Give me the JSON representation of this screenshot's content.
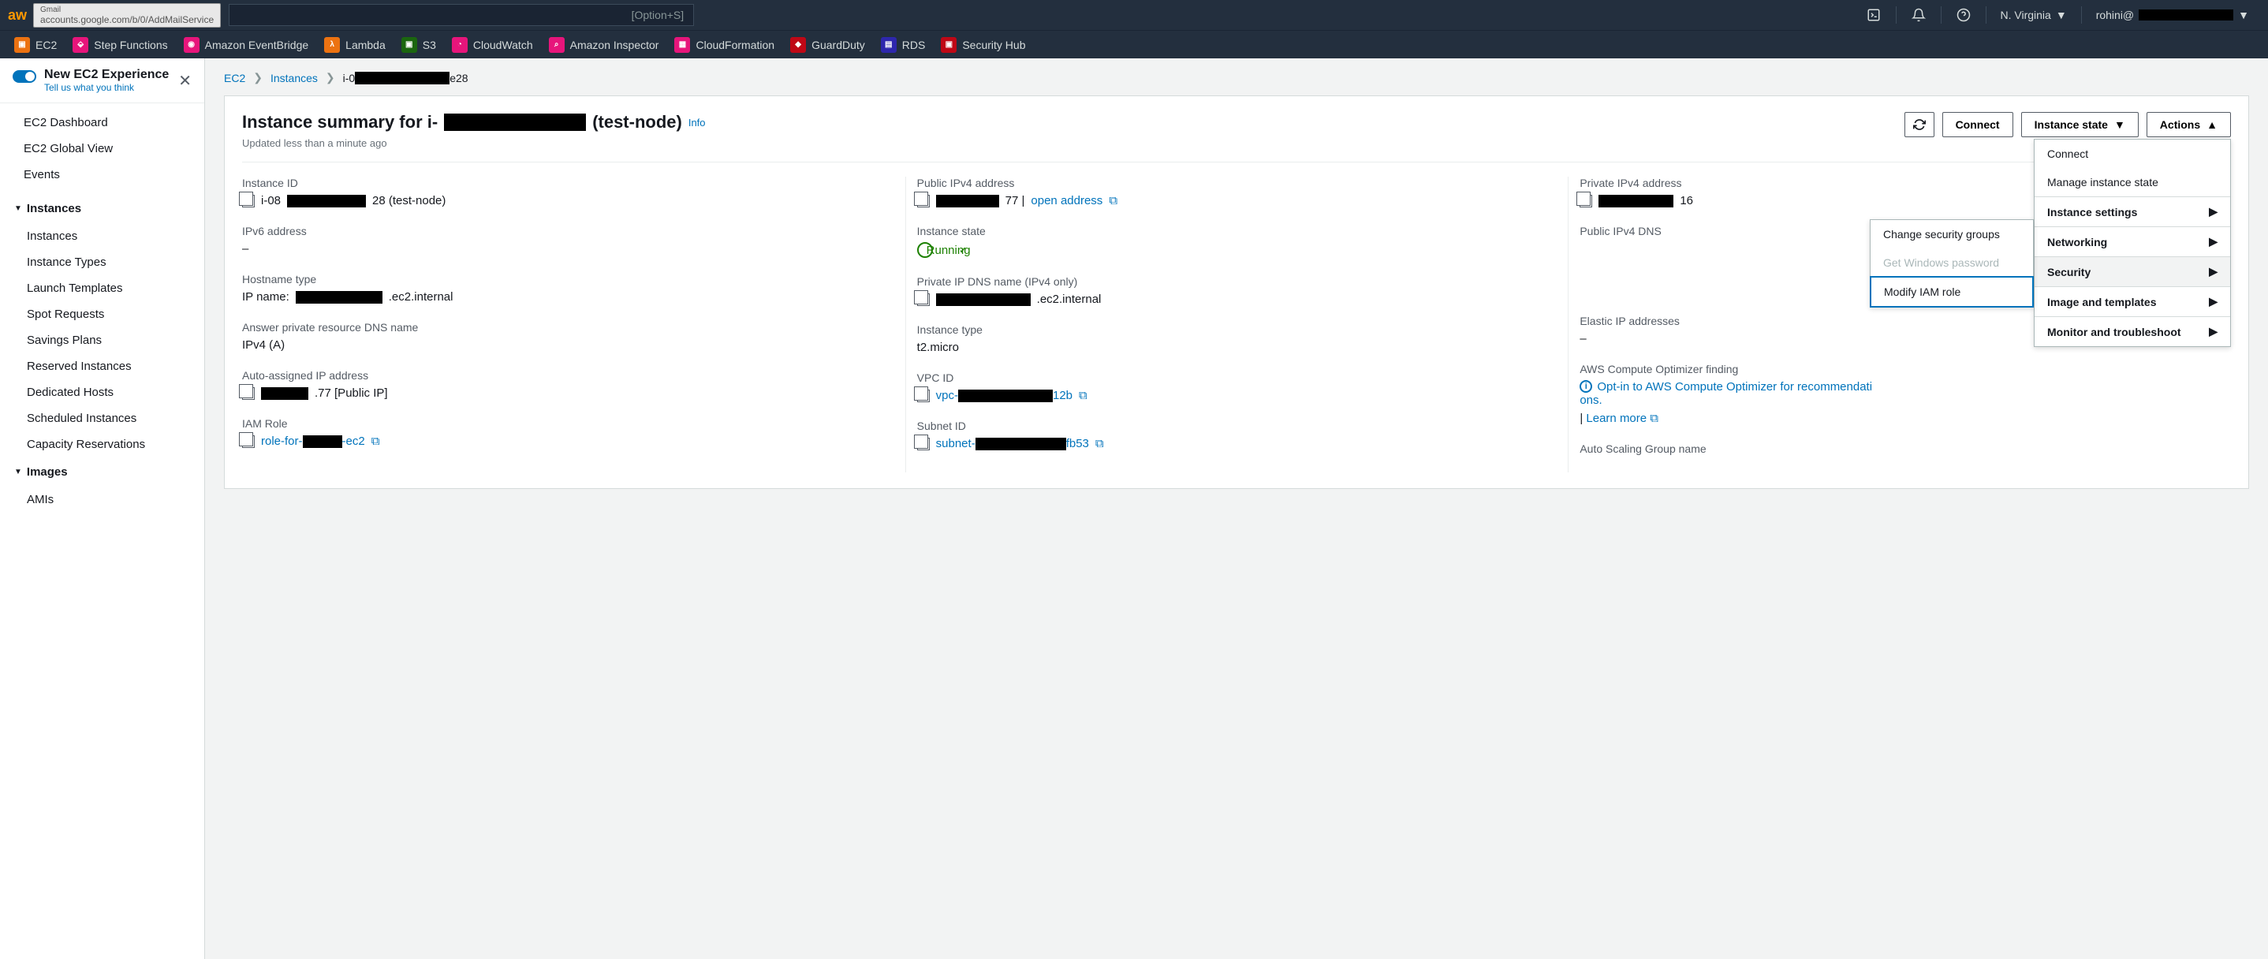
{
  "topnav": {
    "url_hint": "accounts.google.com/b/0/AddMailService",
    "url_hint_top": "Gmail",
    "search_hint": "[Option+S]",
    "region": "N. Virginia",
    "user": "rohini@"
  },
  "services": [
    {
      "name": "EC2",
      "color": "#ec7211"
    },
    {
      "name": "Step Functions",
      "color": "#e7157b"
    },
    {
      "name": "Amazon EventBridge",
      "color": "#e7157b"
    },
    {
      "name": "Lambda",
      "color": "#ec7211"
    },
    {
      "name": "S3",
      "color": "#1b660f"
    },
    {
      "name": "CloudWatch",
      "color": "#e7157b"
    },
    {
      "name": "Amazon Inspector",
      "color": "#e7157b"
    },
    {
      "name": "CloudFormation",
      "color": "#e7157b"
    },
    {
      "name": "GuardDuty",
      "color": "#bf0816"
    },
    {
      "name": "RDS",
      "color": "#2e27ad"
    },
    {
      "name": "Security Hub",
      "color": "#bf0816"
    }
  ],
  "sidebar": {
    "new_exp_title": "New EC2 Experience",
    "new_exp_sub": "Tell us what you think",
    "top": [
      "EC2 Dashboard",
      "EC2 Global View",
      "Events"
    ],
    "instances_header": "Instances",
    "instances": [
      "Instances",
      "Instance Types",
      "Launch Templates",
      "Spot Requests",
      "Savings Plans",
      "Reserved Instances",
      "Dedicated Hosts",
      "Scheduled Instances",
      "Capacity Reservations"
    ],
    "images_header": "Images",
    "images": [
      "AMIs"
    ]
  },
  "crumbs": {
    "root": "EC2",
    "l1": "Instances",
    "l2_prefix": "i-0",
    "l2_suffix": "e28"
  },
  "panel": {
    "title_prefix": "Instance summary for i-",
    "title_suffix": " (test-node)",
    "info": "Info",
    "subtitle": "Updated less than a minute ago",
    "btn_connect": "Connect",
    "btn_state": "Instance state",
    "btn_actions": "Actions"
  },
  "actions_menu": {
    "connect": "Connect",
    "manage_state": "Manage instance state",
    "instance_settings": "Instance settings",
    "networking": "Networking",
    "security": "Security",
    "image_templates": "Image and templates",
    "monitor": "Monitor and troubleshoot"
  },
  "security_submenu": {
    "change_sg": "Change security groups",
    "get_win_pw": "Get Windows password",
    "modify_iam": "Modify IAM role"
  },
  "details": {
    "instance_id_label": "Instance ID",
    "instance_id_prefix": "i-08",
    "instance_id_suffix": "28 (test-node)",
    "public_ipv4_label": "Public IPv4 address",
    "public_ipv4_suffix": "77 |",
    "open_address": "open address",
    "private_ipv4_label": "Private IPv4 address",
    "private_ipv4_suffix": "16",
    "ipv6_label": "IPv6 address",
    "ipv6_value": "–",
    "instance_state_label": "Instance state",
    "instance_state_value": "Running",
    "public_dns_label": "Public IPv4 DNS",
    "hostname_type_label": "Hostname type",
    "hostname_type_prefix": "IP name:",
    "hostname_type_suffix": ".ec2.internal",
    "private_dns_label": "Private IP DNS name (IPv4 only)",
    "private_dns_suffix": ".ec2.internal",
    "answer_dns_label": "Answer private resource DNS name",
    "answer_dns_value": "IPv4 (A)",
    "instance_type_label": "Instance type",
    "instance_type_value": "t2.micro",
    "elastic_ip_label": "Elastic IP addresses",
    "elastic_ip_value": "–",
    "auto_ip_label": "Auto-assigned IP address",
    "auto_ip_suffix": ".77 [Public IP]",
    "vpc_label": "VPC ID",
    "vpc_prefix": "vpc-",
    "vpc_suffix": "12b",
    "optimizer_label": "AWS Compute Optimizer finding",
    "optimizer_text_a": "Opt-in to AWS Compute Optimizer for recommendati",
    "optimizer_text_b": "ons.",
    "optimizer_learn": "Learn more",
    "iam_label": "IAM Role",
    "iam_prefix": "role-for-",
    "iam_suffix": "-ec2",
    "subnet_label": "Subnet ID",
    "subnet_prefix": "subnet-",
    "subnet_suffix": "fb53",
    "asg_label": "Auto Scaling Group name"
  }
}
